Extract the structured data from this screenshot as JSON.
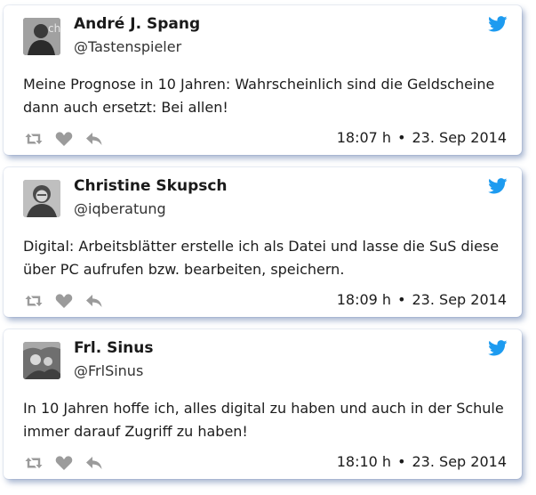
{
  "colors": {
    "twitter_blue": "#1d9bf0",
    "icon_gray": "#9b9b9b",
    "card_shadow": "#4a6fa5"
  },
  "tweets": [
    {
      "name": "André J. Spang",
      "handle": "@Tastenspieler",
      "text": "Meine Prognose in 10 Jahren: Wahrscheinlich sind die Geldscheine dann auch ersetzt: Bei allen!",
      "time": "18:07 h",
      "date": "23. Sep 2014",
      "separator": "•",
      "icons": [
        "retweet-icon",
        "heart-icon",
        "reply-icon",
        "twitter-bird-icon"
      ]
    },
    {
      "name": "Christine Skupsch",
      "handle": "@iqberatung",
      "text": "Digital: Arbeitsblätter erstelle ich als Datei und lasse die SuS diese über PC aufrufen bzw. bearbeiten, speichern.",
      "time": "18:09 h",
      "date": "23. Sep 2014",
      "separator": "•",
      "icons": [
        "retweet-icon",
        "heart-icon",
        "reply-icon",
        "twitter-bird-icon"
      ]
    },
    {
      "name": "Frl. Sinus",
      "handle": "@FrlSinus",
      "text": "In 10 Jahren hoffe ich, alles digital zu haben und auch in der Schule immer darauf Zugriff zu haben!",
      "time": "18:10 h",
      "date": "23. Sep 2014",
      "separator": "•",
      "icons": [
        "retweet-icon",
        "heart-icon",
        "reply-icon",
        "twitter-bird-icon"
      ]
    }
  ]
}
